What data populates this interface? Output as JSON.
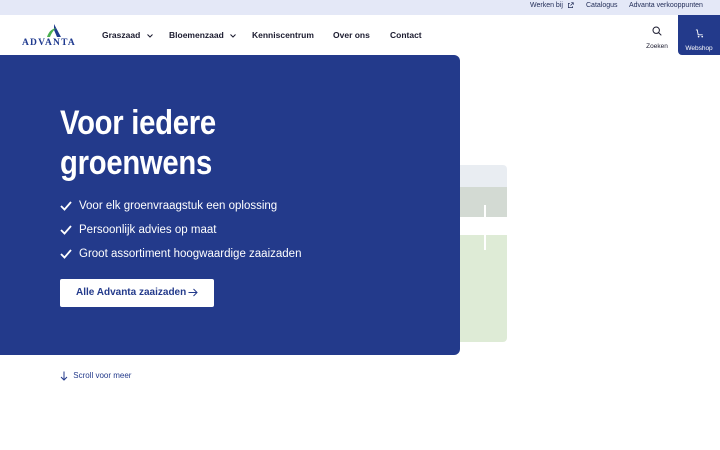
{
  "topbar": {
    "links": [
      "Werken bij",
      "Catalogus",
      "Advanta verkooppunten"
    ]
  },
  "nav": {
    "logo_text": "ADVANTA",
    "items": [
      "Graszaad",
      "Bloemenzaad",
      "Kenniscentrum",
      "Over ons",
      "Contact"
    ],
    "search_label": "Zoeken",
    "webshop_label": "Webshop"
  },
  "hero": {
    "title_line1": "Voor iedere",
    "title_line2": "groenwens",
    "bullets": [
      "Voor elk groenvraagstuk een oplossing",
      "Persoonlijk advies op maat",
      "Groot assortiment hoogwaardige zaaizaden"
    ],
    "cta_label": "Alle Advanta zaaizaden"
  },
  "scroll_label": "Scroll voor meer",
  "colors": {
    "brand_blue": "#233a8b",
    "topbar_bg": "#e4e8f7",
    "logo_green": "#4caf50"
  },
  "icons": [
    "external-link-icon",
    "chevron-down-icon",
    "search-icon",
    "cart-icon",
    "checkmark-icon",
    "arrow-right-icon",
    "arrow-down-icon"
  ]
}
